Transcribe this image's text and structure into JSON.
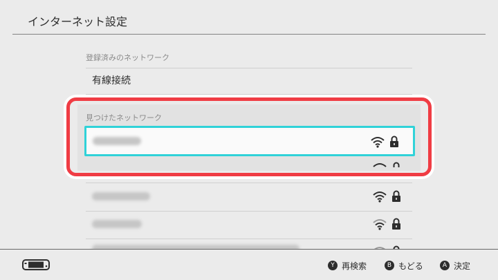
{
  "header": {
    "title": "インターネット設定"
  },
  "main": {
    "registered_label": "登録済みのネットワーク",
    "wired_label": "有線接続",
    "found_label": "見つけたネットワーク"
  },
  "networks": [
    {
      "selected": true,
      "icons": [
        "wifi-icon",
        "lock-icon"
      ]
    },
    {
      "selected": false,
      "icons": [
        "wifi-icon",
        "lock-icon"
      ]
    },
    {
      "selected": false,
      "icons": [
        "wifi-icon",
        "lock-icon"
      ]
    },
    {
      "selected": false,
      "icons": [
        "wifi-icon",
        "lock-icon"
      ]
    },
    {
      "selected": false,
      "icons": [
        "wifi-icon",
        "lock-icon"
      ]
    }
  ],
  "footer": {
    "hints": [
      {
        "button": "Y",
        "label": "再検索"
      },
      {
        "button": "B",
        "label": "もどる"
      },
      {
        "button": "A",
        "label": "決定"
      }
    ]
  },
  "colors": {
    "accent_select": "#2fd2d8",
    "highlight_red": "#f03c44",
    "background": "#ebebeb",
    "text": "#2d2d2d"
  }
}
